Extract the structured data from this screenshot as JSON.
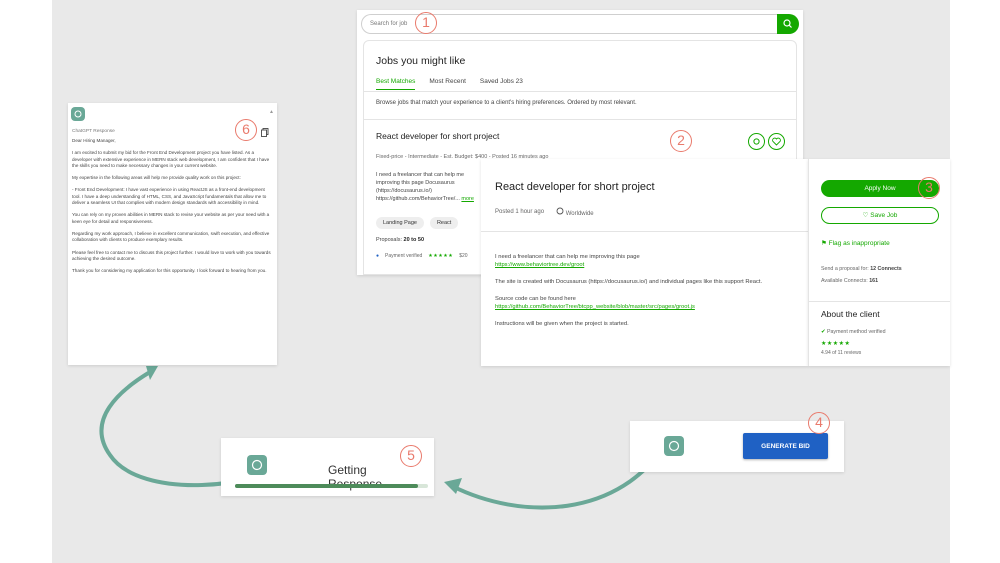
{
  "colors": {
    "upwork_green": "#14a800",
    "bid_blue": "#1f61c4",
    "step_coral": "#e97a6c",
    "arrow_teal": "#6aa897",
    "bg_gray": "#e9e9e9"
  },
  "steps": [
    "1",
    "2",
    "3",
    "4",
    "5",
    "6"
  ],
  "search": {
    "placeholder": "Search for job",
    "button_icon": "search-icon"
  },
  "jobs": {
    "title": "Jobs you might like",
    "tabs": [
      "Best Matches",
      "Most Recent",
      "Saved Jobs 23"
    ],
    "active_tab": 0,
    "browse_text": "Browse jobs that match your experience to a client's hiring preferences. Ordered by most relevant.",
    "card": {
      "title": "React developer for short project",
      "meta": "Fixed-price - Intermediate - Est. Budget: $400 - Posted 16 minutes ago",
      "description": "I need a freelancer that can help me improving this page Docusaurus (https://docusaurus.io/) https://github.com/BehaviorTree/...",
      "more": "more",
      "chips": [
        "Landing Page",
        "React"
      ],
      "proposals_label": "Proposals:",
      "proposals_value": "20 to 50",
      "payment": "Payment verified",
      "spent": "$20"
    }
  },
  "detail": {
    "title": "React developer for short project",
    "posted": "Posted 1 hour ago",
    "location": "Worldwide",
    "body": [
      {
        "text": "I need a freelancer that can help me improving this page",
        "link": "https://www.behaviortree.dev/groot"
      },
      {
        "text": "The site is created with Docusaurus (https://docusaurus.io/) and individual pages like this support React.",
        "link": ""
      },
      {
        "text": "Source code can be found here",
        "link": "https://github.com/BehaviorTree/btcpp_website/blob/master/src/pages/groot.js"
      },
      {
        "text": "Instructions will be given when the project is started.",
        "link": ""
      }
    ]
  },
  "side": {
    "apply": "Apply Now",
    "save": "Save Job",
    "flag": "Flag as inappropriate",
    "send_label": "Send a proposal for:",
    "send_value": "12 Connects",
    "available_label": "Available Connects:",
    "available_value": "161",
    "about": "About the client",
    "payment": "Payment method verified",
    "stars": "★★★★★",
    "reviews": "4.94 of 11 reviews"
  },
  "chat": {
    "label": "ChatGPT Response",
    "paragraphs": [
      "Dear Hiring Manager,",
      "I am excited to submit my bid for the Front End Development project you have listed. As a developer with extensive experience in MERN stack web development, I am confident that I have the skills you need to make necessary changes in your current website.",
      "My expertise in the following areas will help me provide quality work on this project:",
      "- Front End Development: I have vast experience in using ReactJS as a front-end development tool. I have a deep understanding of HTML, CSS, and JavaScript fundamentals that allow me to deliver a seamless UI that complies with modern design standards with accessibility in mind.",
      "You can rely on my proven abilities in MERN stack to revise your website as per your need with a keen eye for detail and responsiveness.",
      "Regarding my work approach, I believe in excellent communication, swift execution, and effective collaboration with clients to produce exemplary results.",
      "Please feel free to contact me to discuss this project further. I would love to work with you towards achieving the desired outcome.",
      "Thank you for considering my application for this opportunity. I look forward to hearing from you."
    ]
  },
  "bid": {
    "button": "GENERATE BID"
  },
  "getting": {
    "text": "Getting Response...",
    "progress": 0.95
  }
}
